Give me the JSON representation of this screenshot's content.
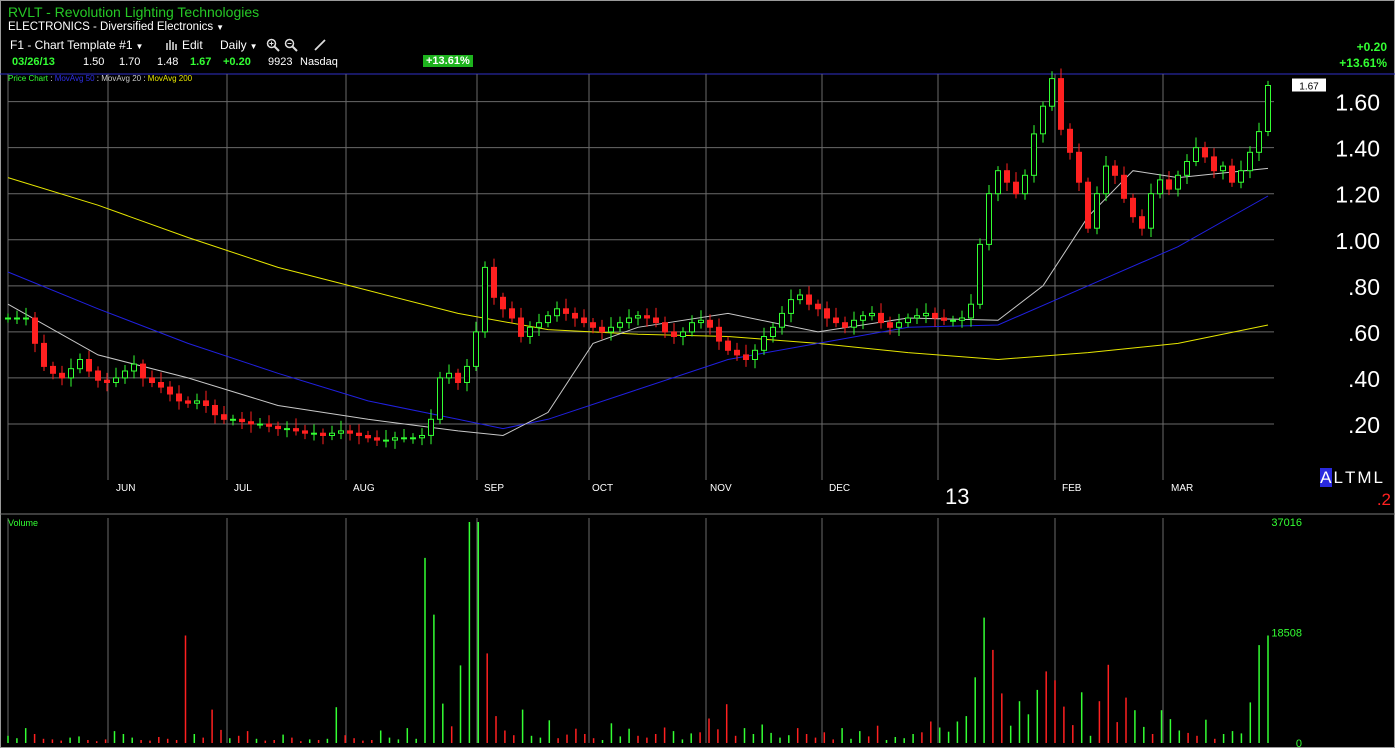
{
  "header": {
    "title": "RVLT - Revolution Lighting Technologies",
    "sector": "ELECTRONICS - Diversified Electronics"
  },
  "toolbar": {
    "template": "F1 - Chart Template #1",
    "edit": "Edit",
    "period": "Daily",
    "icons": [
      "bar-chart-icon",
      "zoom-in-icon",
      "zoom-out-icon",
      "pen-icon"
    ]
  },
  "quote": {
    "date": "03/26/13",
    "open": "1.50",
    "high": "1.70",
    "low": "1.48",
    "last": "1.67",
    "change": "+0.20",
    "volume": "9923",
    "exchange": "Nasdaq",
    "pct_badge": "+13.61%",
    "change_right": "+0.20",
    "pct_right": "+13.61%"
  },
  "legend": {
    "price_chart": "Price Chart",
    "ma50": "MovAvg 50",
    "ma20": "MovAvg 20",
    "ma200": "MovAvg 200"
  },
  "period_selector": [
    "A",
    "L",
    "T",
    "M",
    "L"
  ],
  "period_selected": "A",
  "period_sub": ".2",
  "year_label": "13",
  "volume_label": "Volume",
  "last_price_flag": "1.67",
  "colors": {
    "up": "#33ff33",
    "down": "#ff2020",
    "ma20": "#c8c8c8",
    "ma50": "#2020e0",
    "ma200": "#e6e600",
    "grid": "#6a6a6a",
    "background": "#000000"
  },
  "chart_data": [
    {
      "type": "candlestick",
      "title": "Price Chart",
      "x_labels": [
        "JUN",
        "JUL",
        "AUG",
        "SEP",
        "OCT",
        "NOV",
        "DEC",
        "FEB",
        "MAR"
      ],
      "y_ticks": [
        ".20",
        ".40",
        ".60",
        ".80",
        "1.00",
        "1.20",
        "1.40",
        "1.60"
      ],
      "y_tick_values": [
        0.2,
        0.4,
        0.6,
        0.8,
        1.0,
        1.2,
        1.4,
        1.6
      ],
      "ylim": [
        0.0,
        1.72
      ],
      "closes": [
        0.66,
        0.66,
        0.66,
        0.55,
        0.45,
        0.42,
        0.4,
        0.44,
        0.48,
        0.43,
        0.39,
        0.38,
        0.4,
        0.43,
        0.46,
        0.4,
        0.38,
        0.36,
        0.33,
        0.3,
        0.29,
        0.3,
        0.28,
        0.24,
        0.22,
        0.22,
        0.21,
        0.2,
        0.2,
        0.19,
        0.18,
        0.18,
        0.17,
        0.16,
        0.16,
        0.15,
        0.16,
        0.17,
        0.16,
        0.15,
        0.14,
        0.13,
        0.13,
        0.14,
        0.14,
        0.14,
        0.15,
        0.22,
        0.4,
        0.42,
        0.38,
        0.45,
        0.6,
        0.88,
        0.75,
        0.7,
        0.66,
        0.58,
        0.62,
        0.64,
        0.67,
        0.7,
        0.68,
        0.66,
        0.64,
        0.62,
        0.6,
        0.62,
        0.64,
        0.66,
        0.67,
        0.66,
        0.64,
        0.6,
        0.58,
        0.6,
        0.64,
        0.65,
        0.62,
        0.56,
        0.52,
        0.5,
        0.48,
        0.52,
        0.58,
        0.62,
        0.68,
        0.74,
        0.76,
        0.72,
        0.7,
        0.66,
        0.64,
        0.62,
        0.65,
        0.67,
        0.68,
        0.64,
        0.62,
        0.64,
        0.66,
        0.67,
        0.68,
        0.66,
        0.65,
        0.65,
        0.66,
        0.72,
        0.98,
        1.2,
        1.3,
        1.25,
        1.2,
        1.28,
        1.46,
        1.58,
        1.7,
        1.48,
        1.38,
        1.25,
        1.05,
        1.2,
        1.32,
        1.28,
        1.18,
        1.1,
        1.05,
        1.2,
        1.26,
        1.22,
        1.28,
        1.34,
        1.4,
        1.36,
        1.3,
        1.32,
        1.25,
        1.3,
        1.38,
        1.47,
        1.67
      ],
      "current_price": 1.67
    },
    {
      "type": "line",
      "series": [
        {
          "name": "MovAvg 200",
          "color": "#e6e600",
          "x": [
            0,
            10,
            20,
            30,
            40,
            50,
            60,
            70,
            80,
            90,
            100,
            110,
            120,
            130,
            140
          ],
          "y": [
            1.27,
            1.15,
            1.01,
            0.88,
            0.78,
            0.68,
            0.61,
            0.59,
            0.58,
            0.55,
            0.51,
            0.48,
            0.51,
            0.55,
            0.63
          ]
        },
        {
          "name": "MovAvg 50",
          "color": "#2020e0",
          "x": [
            0,
            10,
            20,
            30,
            40,
            50,
            55,
            60,
            70,
            80,
            90,
            100,
            110,
            120,
            130,
            140
          ],
          "y": [
            0.86,
            0.7,
            0.55,
            0.42,
            0.3,
            0.22,
            0.18,
            0.22,
            0.35,
            0.48,
            0.55,
            0.62,
            0.63,
            0.8,
            0.97,
            1.19
          ]
        },
        {
          "name": "MovAvg 20",
          "color": "#c8c8c8",
          "x": [
            0,
            10,
            20,
            30,
            40,
            50,
            55,
            60,
            65,
            70,
            80,
            90,
            100,
            110,
            115,
            120,
            125,
            130,
            140
          ],
          "y": [
            0.72,
            0.5,
            0.4,
            0.28,
            0.22,
            0.17,
            0.15,
            0.25,
            0.55,
            0.62,
            0.68,
            0.6,
            0.66,
            0.65,
            0.8,
            1.1,
            1.3,
            1.27,
            1.31
          ]
        }
      ]
    },
    {
      "type": "bar",
      "title": "Volume",
      "y_ticks": [
        "0",
        "18508",
        "37016"
      ],
      "y_tick_values": [
        0,
        18508,
        37016
      ],
      "ylim": [
        0,
        37016
      ],
      "values": [
        1200,
        800,
        2500,
        1500,
        700,
        600,
        400,
        900,
        1100,
        500,
        300,
        600,
        2000,
        1500,
        900,
        500,
        400,
        1000,
        700,
        500,
        18000,
        1500,
        900,
        5600,
        2200,
        800,
        1200,
        2000,
        700,
        400,
        500,
        1400,
        900,
        300,
        600,
        500,
        700,
        6000,
        1300,
        800,
        400,
        500,
        2100,
        900,
        600,
        2500,
        700,
        31000,
        21500,
        6600,
        2800,
        13000,
        37016,
        37016,
        15000,
        4500,
        2100,
        1300,
        5600,
        1200,
        900,
        3800,
        800,
        1400,
        2400,
        1500,
        800,
        500,
        3300,
        1100,
        2400,
        1200,
        900,
        1500,
        2600,
        2000,
        600,
        1600,
        1800,
        4100,
        2300,
        6500,
        1200,
        2500,
        1500,
        3100,
        1700,
        900,
        1300,
        2500,
        1500,
        900,
        1800,
        600,
        2500,
        700,
        2000,
        1100,
        2900,
        500,
        1000,
        800,
        1500,
        1800,
        3600,
        2600,
        1900,
        3600,
        4500,
        11000,
        21000,
        15600,
        8300,
        2900,
        7000,
        4800,
        8900,
        12000,
        10500,
        6100,
        3000,
        8500,
        1200,
        7000,
        13100,
        3500,
        7600,
        5500,
        2700,
        1500,
        5500,
        4000,
        2100,
        1700,
        1200,
        3900,
        700,
        1500,
        2000,
        1600,
        6800,
        16400,
        18000
      ]
    }
  ]
}
